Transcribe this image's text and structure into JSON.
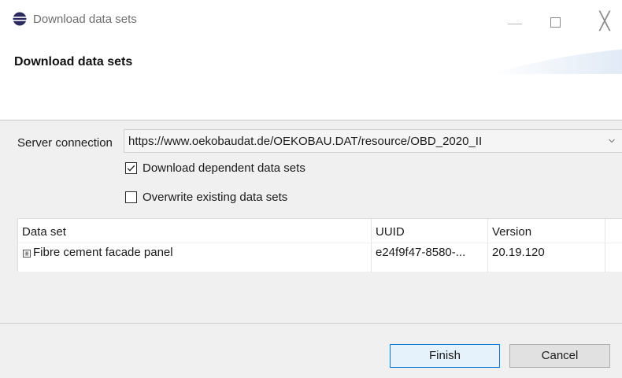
{
  "window": {
    "title": "Download data sets",
    "controls": {
      "minimize_icon": "minimize-icon",
      "maximize_icon": "maximize-icon",
      "close_glyph": "╳"
    }
  },
  "header": {
    "title": "Download data sets"
  },
  "form": {
    "server_label": "Server connection",
    "server_value": "https://www.oekobaudat.de/OEKOBAU.DAT/resource/OBD_2020_II",
    "download_dependent": {
      "label": "Download dependent data sets",
      "checked": true
    },
    "overwrite_existing": {
      "label": "Overwrite existing data sets",
      "checked": false
    }
  },
  "table": {
    "columns": [
      "Data set",
      "UUID",
      "Version"
    ],
    "rows": [
      {
        "name": "Fibre cement facade panel",
        "uuid": "e24f9f47-8580-...",
        "version": "20.19.120",
        "icon": "expand-icon"
      }
    ]
  },
  "buttons": {
    "finish": "Finish",
    "cancel": "Cancel"
  },
  "colors": {
    "accent": "#0078d7",
    "panel_bg": "#f0f0f0",
    "header_bg": "#ffffff",
    "app_icon": "#2b2a5e"
  }
}
